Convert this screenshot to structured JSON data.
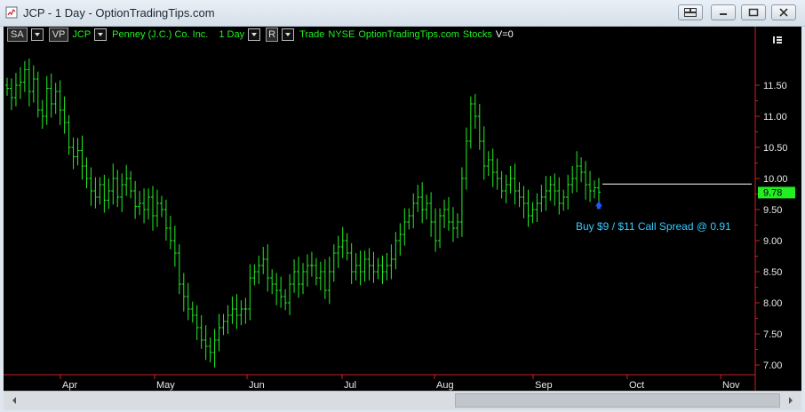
{
  "window": {
    "title": "JCP - 1 Day - OptionTradingTips.com"
  },
  "header": {
    "sa_label": "SA",
    "vp_label": "VP",
    "symbol": "JCP",
    "company": "Penney (J.C.) Co. Inc.",
    "interval": "1 Day",
    "r_label": "R",
    "type": "Trade",
    "exchange": "NYSE",
    "source": "OptionTradingTips.com",
    "category": "Stocks",
    "volume": "V=0"
  },
  "annotation": {
    "text": "Buy $9 / $11 Call Spread @ 0.91"
  },
  "price_tag": "9.78",
  "colors": {
    "bars": "#22ee22",
    "axis": "#cc2020",
    "annotation": "#33ccff",
    "arrow": "#2255ff",
    "price_tag_bg": "#22ee22"
  },
  "chart_data": {
    "type": "ohlc-bar",
    "current_price": 9.78,
    "last_close_line": 9.91,
    "y_ticks": [
      "11.50",
      "11.00",
      "10.50",
      "10.00",
      "9.50",
      "9.00",
      "8.50",
      "8.00",
      "7.50",
      "7.00"
    ],
    "x_ticks": [
      "Apr",
      "May",
      "Jun",
      "Jul",
      "Aug",
      "Sep",
      "Oct",
      "Nov"
    ],
    "ylim": [
      6.8,
      12.0
    ],
    "closes": [
      11.45,
      11.3,
      11.5,
      11.55,
      11.75,
      11.4,
      11.6,
      11.1,
      11.0,
      11.45,
      11.2,
      11.4,
      11.1,
      10.9,
      10.5,
      10.35,
      10.45,
      10.2,
      10.0,
      9.8,
      9.7,
      9.9,
      9.65,
      9.8,
      10.0,
      9.7,
      9.9,
      10.0,
      9.8,
      9.55,
      9.6,
      9.5,
      9.7,
      9.4,
      9.6,
      9.5,
      9.2,
      9.0,
      8.8,
      8.3,
      8.1,
      7.9,
      7.8,
      7.6,
      7.4,
      7.3,
      7.2,
      7.4,
      7.6,
      7.7,
      7.8,
      7.9,
      7.8,
      7.9,
      7.9,
      8.4,
      8.5,
      8.6,
      8.7,
      8.4,
      8.3,
      8.2,
      8.1,
      8.0,
      8.3,
      8.5,
      8.3,
      8.5,
      8.6,
      8.6,
      8.4,
      8.5,
      8.2,
      8.5,
      8.8,
      8.9,
      9.0,
      8.8,
      8.5,
      8.6,
      8.5,
      8.7,
      8.6,
      8.5,
      8.6,
      8.5,
      8.6,
      8.7,
      9.0,
      9.1,
      9.3,
      9.4,
      9.6,
      9.7,
      9.5,
      9.6,
      9.3,
      9.0,
      9.4,
      9.5,
      9.3,
      9.2,
      9.3,
      10.0,
      10.6,
      11.2,
      11.0,
      10.6,
      10.2,
      10.3,
      10.1,
      10.0,
      9.8,
      9.9,
      10.0,
      9.8,
      9.7,
      9.6,
      9.4,
      9.5,
      9.6,
      9.7,
      9.8,
      9.9,
      9.8,
      9.6,
      9.7,
      9.9,
      10.0,
      10.2,
      10.1,
      9.9,
      9.8,
      9.85,
      9.78
    ]
  }
}
